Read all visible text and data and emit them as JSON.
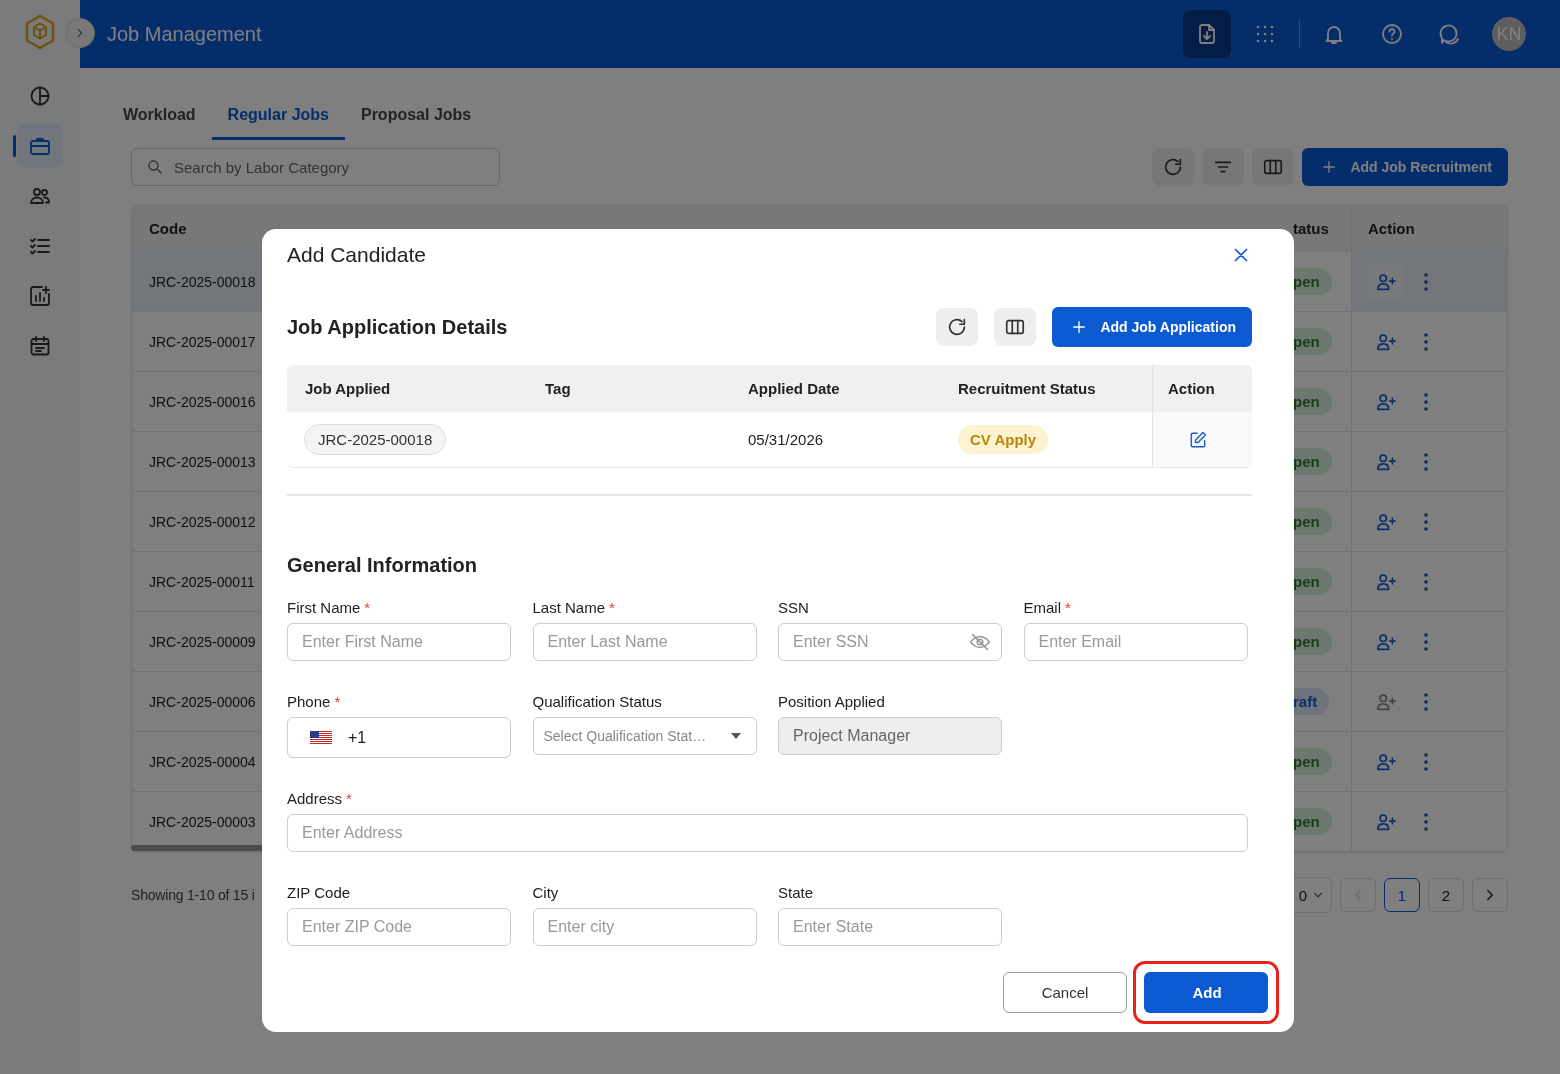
{
  "sidebar": {
    "items": [
      {
        "kind": "dashboard",
        "selected": false
      },
      {
        "kind": "briefcase",
        "selected": true
      },
      {
        "kind": "people",
        "selected": false
      },
      {
        "kind": "checklist",
        "selected": false
      },
      {
        "kind": "report",
        "selected": false
      },
      {
        "kind": "calendar",
        "selected": false
      }
    ]
  },
  "topbar": {
    "title": "Job Management",
    "icons": [
      {
        "kind": "file-download",
        "selected": true
      },
      {
        "kind": "apps",
        "selected": false
      },
      {
        "kind": "bell",
        "selected": false
      },
      {
        "kind": "help",
        "selected": false
      },
      {
        "kind": "chat",
        "selected": false
      }
    ],
    "avatar": "KN"
  },
  "tabs": [
    {
      "label": "Workload",
      "selected": false
    },
    {
      "label": "Regular Jobs",
      "selected": true
    },
    {
      "label": "Proposal Jobs",
      "selected": false
    }
  ],
  "search": {
    "placeholder": "Search by Labor Category"
  },
  "add_button": "Add Job Recruitment",
  "table": {
    "columns": [
      "Code",
      "tatus",
      "Action"
    ],
    "rows": [
      {
        "code": "JRC-2025-00018",
        "status": "pen",
        "kind": "open",
        "selected": true,
        "assign_disabled": false
      },
      {
        "code": "JRC-2025-00017",
        "status": "pen",
        "kind": "open",
        "selected": false,
        "assign_disabled": false
      },
      {
        "code": "JRC-2025-00016",
        "status": "pen",
        "kind": "open",
        "selected": false,
        "assign_disabled": false
      },
      {
        "code": "JRC-2025-00013",
        "status": "pen",
        "kind": "open",
        "selected": false,
        "assign_disabled": false
      },
      {
        "code": "JRC-2025-00012",
        "status": "pen",
        "kind": "open",
        "selected": false,
        "assign_disabled": false
      },
      {
        "code": "JRC-2025-00011",
        "status": "pen",
        "kind": "open",
        "selected": false,
        "assign_disabled": false
      },
      {
        "code": "JRC-2025-00009",
        "status": "pen",
        "kind": "open",
        "selected": false,
        "assign_disabled": false
      },
      {
        "code": "JRC-2025-00006",
        "status": "raft",
        "kind": "draft",
        "selected": false,
        "assign_disabled": true
      },
      {
        "code": "JRC-2025-00004",
        "status": "pen",
        "kind": "open",
        "selected": false,
        "assign_disabled": false
      },
      {
        "code": "JRC-2025-00003",
        "status": "pen",
        "kind": "open",
        "selected": false,
        "assign_disabled": false
      }
    ]
  },
  "pagination": {
    "summary": "Showing 1-10 of 15 i",
    "page_size": "0",
    "pages": [
      {
        "label": "1",
        "selected": true
      },
      {
        "label": "2",
        "selected": false
      }
    ]
  },
  "modal": {
    "title": "Add Candidate",
    "applications": {
      "title": "Job Application Details",
      "add_button": "Add Job Application",
      "columns": [
        "Job Applied",
        "Tag",
        "Applied Date",
        "Recruitment Status",
        "Action"
      ],
      "rows": [
        {
          "job": "JRC-2025-00018",
          "date": "05/31/2026",
          "status": "CV Apply"
        }
      ]
    },
    "general": {
      "title": "General Information",
      "fields": [
        {
          "label": "First Name",
          "required_mark": "*",
          "kind": "text",
          "placeholder": "Enter First Name"
        },
        {
          "label": "Last Name",
          "required_mark": "*",
          "kind": "text",
          "placeholder": "Enter Last Name"
        },
        {
          "label": "SSN",
          "kind": "secret",
          "placeholder": "Enter SSN"
        },
        {
          "label": "Email",
          "required_mark": "*",
          "kind": "text",
          "placeholder": "Enter Email"
        },
        {
          "label": "Phone",
          "required_mark": "*",
          "kind": "phone",
          "value": "+1"
        },
        {
          "label": "Qualification Status",
          "kind": "select",
          "placeholder": "Select Qualification Stat…"
        },
        {
          "label": "Position Applied",
          "kind": "readonly",
          "value": "Project Manager"
        },
        {
          "label": "Address",
          "required_mark": "*",
          "kind": "wide",
          "placeholder": "Enter Address"
        },
        {
          "label": "ZIP Code",
          "kind": "text",
          "placeholder": "Enter ZIP Code"
        },
        {
          "label": "City",
          "kind": "text",
          "placeholder": "Enter city"
        },
        {
          "label": "State",
          "kind": "text",
          "placeholder": "Enter State"
        }
      ]
    },
    "buttons": [
      {
        "label": "Cancel",
        "kind": "secondary",
        "highlighted": false
      },
      {
        "label": "Add",
        "kind": "primary",
        "highlighted": true
      }
    ]
  }
}
